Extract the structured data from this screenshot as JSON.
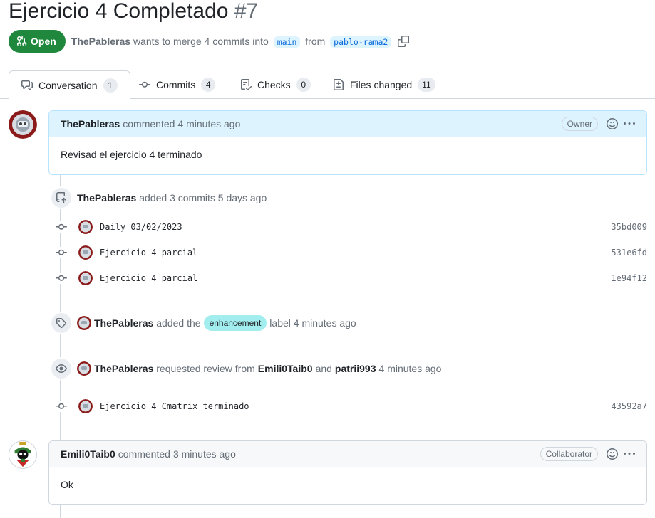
{
  "pr": {
    "title": "Ejercicio 4 Completado",
    "number": "#7",
    "state": "Open",
    "author": "ThePableras",
    "merge_text": "wants to merge 4 commits into",
    "base_branch": "main",
    "from_text": "from",
    "head_branch": "pablo-rama2"
  },
  "tabs": [
    {
      "label": "Conversation",
      "count": "1",
      "icon": "comment-discussion-icon"
    },
    {
      "label": "Commits",
      "count": "4",
      "icon": "git-commit-icon"
    },
    {
      "label": "Checks",
      "count": "0",
      "icon": "checklist-icon"
    },
    {
      "label": "Files changed",
      "count": "11",
      "icon": "file-diff-icon"
    }
  ],
  "comments": [
    {
      "author": "ThePableras",
      "action": "commented",
      "time": "4 minutes ago",
      "role": "Owner",
      "body": "Revisad el ejercicio 4 terminado"
    },
    {
      "author": "Emili0Taib0",
      "action": "commented",
      "time": "3 minutes ago",
      "role": "Collaborator",
      "body": "Ok"
    }
  ],
  "events": {
    "commits_added": {
      "actor": "ThePableras",
      "text": "added 3 commits 5 days ago"
    },
    "label_added": {
      "actor": "ThePableras",
      "text_before": "added the",
      "label": "enhancement",
      "label_color": "#a2eeef",
      "text_after": "label 4 minutes ago"
    },
    "review_requested": {
      "actor": "ThePableras",
      "text_before": "requested review from",
      "reviewer1": "Emili0Taib0",
      "and": "and",
      "reviewer2": "patrii993",
      "time": "4 minutes ago"
    }
  },
  "commits": [
    {
      "message": "Daily 03/02/2023",
      "sha": "35bd009"
    },
    {
      "message": "Ejercicio 4 parcial",
      "sha": "531e6fd"
    },
    {
      "message": "Ejercicio 4 parcial",
      "sha": "1e94f12"
    },
    {
      "message": "Ejercicio 4 Cmatrix terminado",
      "sha": "43592a7"
    }
  ],
  "colors": {
    "open_green": "#1f883d",
    "link_blue": "#0969da",
    "branch_bg": "#ddf4ff",
    "owner_header_bg": "#ddf4ff"
  }
}
